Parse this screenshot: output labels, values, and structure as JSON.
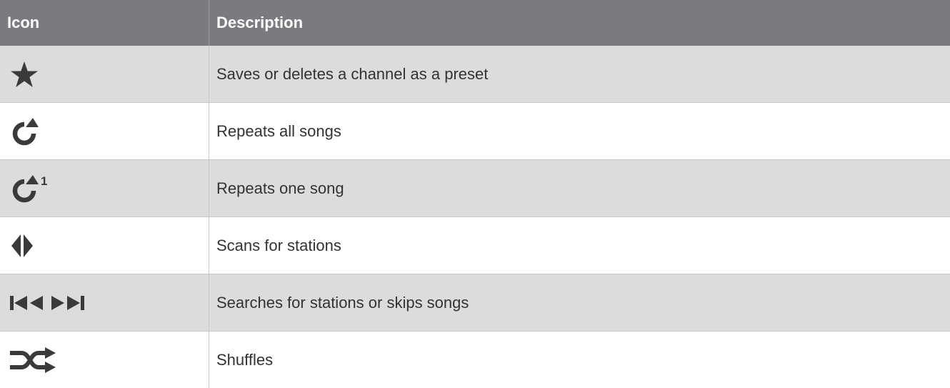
{
  "table": {
    "headers": {
      "icon": "Icon",
      "description": "Description"
    },
    "rows": [
      {
        "icon": "star-icon",
        "description": "Saves or deletes a channel as a preset"
      },
      {
        "icon": "repeat-icon",
        "description": "Repeats all songs"
      },
      {
        "icon": "repeat-one-icon",
        "icon_superscript": "1",
        "description": "Repeats one song"
      },
      {
        "icon": "scan-icon",
        "description": "Scans for stations"
      },
      {
        "icon": "seek-skip-icon",
        "description": "Searches for stations or skips songs"
      },
      {
        "icon": "shuffle-icon",
        "description": "Shuffles"
      }
    ]
  },
  "colors": {
    "header_background": "#7b7b7f",
    "shaded_row": "#dcdcdf",
    "icon": "#3a3a3a"
  }
}
